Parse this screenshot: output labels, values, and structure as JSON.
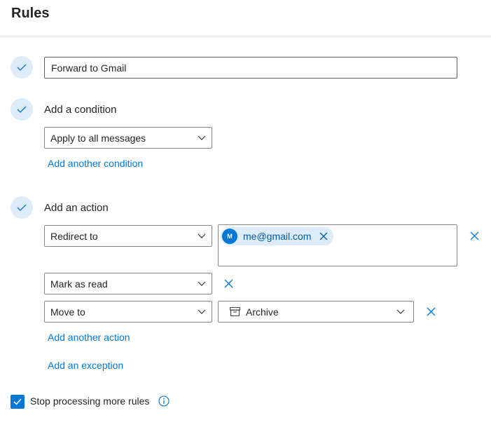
{
  "header": {
    "title": "Rules"
  },
  "rule_name": {
    "value": "Forward to Gmail"
  },
  "condition": {
    "heading": "Add a condition",
    "selected": "Apply to all messages",
    "add_link": "Add another condition"
  },
  "action": {
    "heading": "Add an action",
    "rows": [
      {
        "selected": "Redirect to"
      },
      {
        "selected": "Mark as read"
      },
      {
        "selected": "Move to"
      }
    ],
    "recipient": {
      "initial": "M",
      "email": "me@gmail.com"
    },
    "folder": {
      "icon": "archive-icon",
      "label": "Archive"
    },
    "add_link": "Add another action"
  },
  "exception": {
    "add_link": "Add an exception"
  },
  "stop_processing": {
    "label": "Stop processing more rules",
    "checked": true
  },
  "colors": {
    "accent": "#0078d4",
    "check_bg": "#deecf9",
    "text": "#252423"
  }
}
